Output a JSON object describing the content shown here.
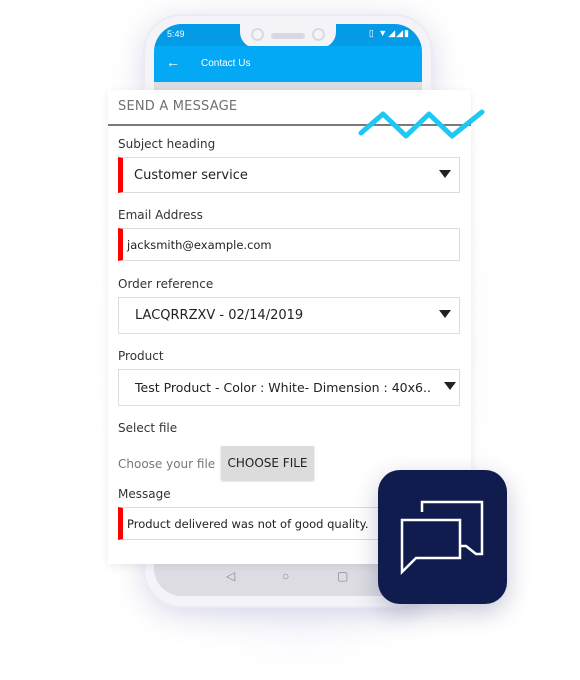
{
  "status_bar": {
    "time": "5:49",
    "icons": [
      "vibrate-icon",
      "wifi-icon",
      "signal-icon",
      "signal-icon",
      "battery-icon"
    ],
    "icons_glyphs": "▯ ▼◢◢▮"
  },
  "app_bar": {
    "back_icon": "←",
    "title": "Contact Us",
    "color": "#03a9f4"
  },
  "form": {
    "title": "SEND A MESSAGE",
    "subject": {
      "label": "Subject heading",
      "value": "Customer service"
    },
    "email": {
      "label": "Email Address",
      "value": "jacksmith@example.com"
    },
    "order": {
      "label": "Order reference",
      "value": "LACQRRZXV - 02/14/2019"
    },
    "product": {
      "label": "Product",
      "value": "Test Product - Color : White- Dimension : 40x6.."
    },
    "file": {
      "label": "Select file",
      "hint": "Choose your file",
      "button": "CHOOSE FILE"
    },
    "message": {
      "label": "Message",
      "value": "Product delivered was not of good quality."
    },
    "required_color": "#ff0000"
  },
  "nav_bar": {
    "back": "◁",
    "home": "○",
    "recent": "▢"
  },
  "decor": {
    "zigzag_color": "#1ec8f5",
    "chat_tile_color": "#101c4e"
  }
}
